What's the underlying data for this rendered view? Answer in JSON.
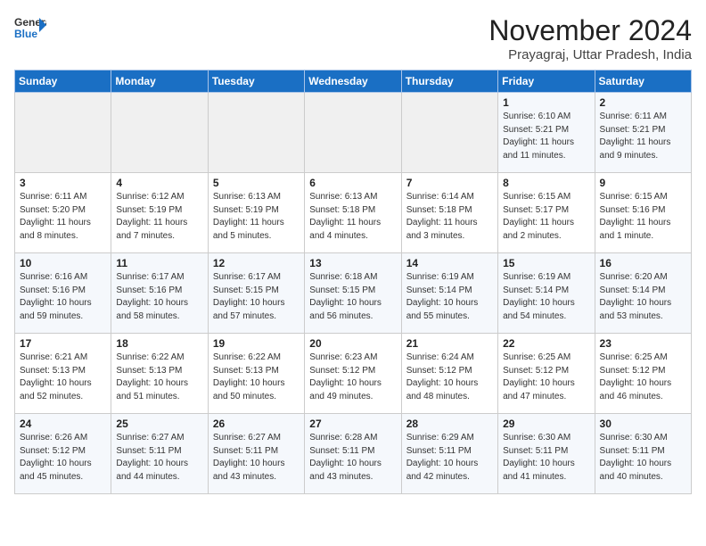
{
  "header": {
    "logo_general": "General",
    "logo_blue": "Blue",
    "month_title": "November 2024",
    "subtitle": "Prayagraj, Uttar Pradesh, India"
  },
  "weekdays": [
    "Sunday",
    "Monday",
    "Tuesday",
    "Wednesday",
    "Thursday",
    "Friday",
    "Saturday"
  ],
  "weeks": [
    [
      {
        "day": "",
        "sunrise": "",
        "sunset": "",
        "daylight": ""
      },
      {
        "day": "",
        "sunrise": "",
        "sunset": "",
        "daylight": ""
      },
      {
        "day": "",
        "sunrise": "",
        "sunset": "",
        "daylight": ""
      },
      {
        "day": "",
        "sunrise": "",
        "sunset": "",
        "daylight": ""
      },
      {
        "day": "",
        "sunrise": "",
        "sunset": "",
        "daylight": ""
      },
      {
        "day": "1",
        "sunrise": "Sunrise: 6:10 AM",
        "sunset": "Sunset: 5:21 PM",
        "daylight": "Daylight: 11 hours and 11 minutes."
      },
      {
        "day": "2",
        "sunrise": "Sunrise: 6:11 AM",
        "sunset": "Sunset: 5:21 PM",
        "daylight": "Daylight: 11 hours and 9 minutes."
      }
    ],
    [
      {
        "day": "3",
        "sunrise": "Sunrise: 6:11 AM",
        "sunset": "Sunset: 5:20 PM",
        "daylight": "Daylight: 11 hours and 8 minutes."
      },
      {
        "day": "4",
        "sunrise": "Sunrise: 6:12 AM",
        "sunset": "Sunset: 5:19 PM",
        "daylight": "Daylight: 11 hours and 7 minutes."
      },
      {
        "day": "5",
        "sunrise": "Sunrise: 6:13 AM",
        "sunset": "Sunset: 5:19 PM",
        "daylight": "Daylight: 11 hours and 5 minutes."
      },
      {
        "day": "6",
        "sunrise": "Sunrise: 6:13 AM",
        "sunset": "Sunset: 5:18 PM",
        "daylight": "Daylight: 11 hours and 4 minutes."
      },
      {
        "day": "7",
        "sunrise": "Sunrise: 6:14 AM",
        "sunset": "Sunset: 5:18 PM",
        "daylight": "Daylight: 11 hours and 3 minutes."
      },
      {
        "day": "8",
        "sunrise": "Sunrise: 6:15 AM",
        "sunset": "Sunset: 5:17 PM",
        "daylight": "Daylight: 11 hours and 2 minutes."
      },
      {
        "day": "9",
        "sunrise": "Sunrise: 6:15 AM",
        "sunset": "Sunset: 5:16 PM",
        "daylight": "Daylight: 11 hours and 1 minute."
      }
    ],
    [
      {
        "day": "10",
        "sunrise": "Sunrise: 6:16 AM",
        "sunset": "Sunset: 5:16 PM",
        "daylight": "Daylight: 10 hours and 59 minutes."
      },
      {
        "day": "11",
        "sunrise": "Sunrise: 6:17 AM",
        "sunset": "Sunset: 5:16 PM",
        "daylight": "Daylight: 10 hours and 58 minutes."
      },
      {
        "day": "12",
        "sunrise": "Sunrise: 6:17 AM",
        "sunset": "Sunset: 5:15 PM",
        "daylight": "Daylight: 10 hours and 57 minutes."
      },
      {
        "day": "13",
        "sunrise": "Sunrise: 6:18 AM",
        "sunset": "Sunset: 5:15 PM",
        "daylight": "Daylight: 10 hours and 56 minutes."
      },
      {
        "day": "14",
        "sunrise": "Sunrise: 6:19 AM",
        "sunset": "Sunset: 5:14 PM",
        "daylight": "Daylight: 10 hours and 55 minutes."
      },
      {
        "day": "15",
        "sunrise": "Sunrise: 6:19 AM",
        "sunset": "Sunset: 5:14 PM",
        "daylight": "Daylight: 10 hours and 54 minutes."
      },
      {
        "day": "16",
        "sunrise": "Sunrise: 6:20 AM",
        "sunset": "Sunset: 5:14 PM",
        "daylight": "Daylight: 10 hours and 53 minutes."
      }
    ],
    [
      {
        "day": "17",
        "sunrise": "Sunrise: 6:21 AM",
        "sunset": "Sunset: 5:13 PM",
        "daylight": "Daylight: 10 hours and 52 minutes."
      },
      {
        "day": "18",
        "sunrise": "Sunrise: 6:22 AM",
        "sunset": "Sunset: 5:13 PM",
        "daylight": "Daylight: 10 hours and 51 minutes."
      },
      {
        "day": "19",
        "sunrise": "Sunrise: 6:22 AM",
        "sunset": "Sunset: 5:13 PM",
        "daylight": "Daylight: 10 hours and 50 minutes."
      },
      {
        "day": "20",
        "sunrise": "Sunrise: 6:23 AM",
        "sunset": "Sunset: 5:12 PM",
        "daylight": "Daylight: 10 hours and 49 minutes."
      },
      {
        "day": "21",
        "sunrise": "Sunrise: 6:24 AM",
        "sunset": "Sunset: 5:12 PM",
        "daylight": "Daylight: 10 hours and 48 minutes."
      },
      {
        "day": "22",
        "sunrise": "Sunrise: 6:25 AM",
        "sunset": "Sunset: 5:12 PM",
        "daylight": "Daylight: 10 hours and 47 minutes."
      },
      {
        "day": "23",
        "sunrise": "Sunrise: 6:25 AM",
        "sunset": "Sunset: 5:12 PM",
        "daylight": "Daylight: 10 hours and 46 minutes."
      }
    ],
    [
      {
        "day": "24",
        "sunrise": "Sunrise: 6:26 AM",
        "sunset": "Sunset: 5:12 PM",
        "daylight": "Daylight: 10 hours and 45 minutes."
      },
      {
        "day": "25",
        "sunrise": "Sunrise: 6:27 AM",
        "sunset": "Sunset: 5:11 PM",
        "daylight": "Daylight: 10 hours and 44 minutes."
      },
      {
        "day": "26",
        "sunrise": "Sunrise: 6:27 AM",
        "sunset": "Sunset: 5:11 PM",
        "daylight": "Daylight: 10 hours and 43 minutes."
      },
      {
        "day": "27",
        "sunrise": "Sunrise: 6:28 AM",
        "sunset": "Sunset: 5:11 PM",
        "daylight": "Daylight: 10 hours and 43 minutes."
      },
      {
        "day": "28",
        "sunrise": "Sunrise: 6:29 AM",
        "sunset": "Sunset: 5:11 PM",
        "daylight": "Daylight: 10 hours and 42 minutes."
      },
      {
        "day": "29",
        "sunrise": "Sunrise: 6:30 AM",
        "sunset": "Sunset: 5:11 PM",
        "daylight": "Daylight: 10 hours and 41 minutes."
      },
      {
        "day": "30",
        "sunrise": "Sunrise: 6:30 AM",
        "sunset": "Sunset: 5:11 PM",
        "daylight": "Daylight: 10 hours and 40 minutes."
      }
    ]
  ]
}
